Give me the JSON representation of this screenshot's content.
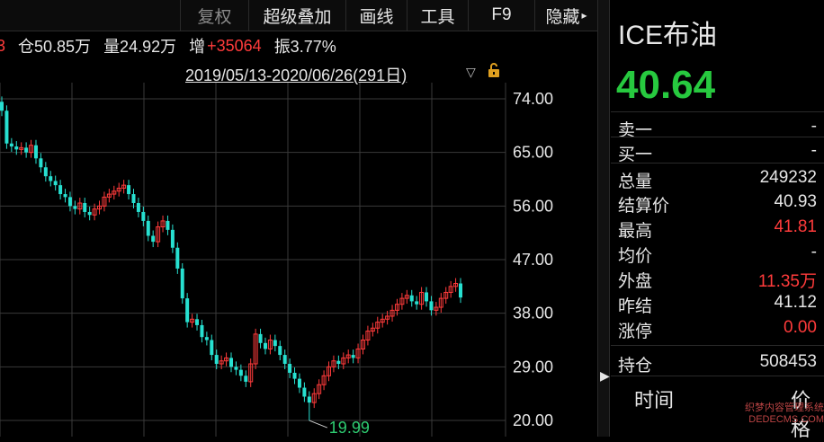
{
  "toolbar": {
    "items": [
      "复权",
      "超级叠加",
      "画线",
      "工具",
      "F9",
      "隐藏"
    ]
  },
  "infobar": {
    "open_interest": "仓50.85万",
    "volume": "量24.92万",
    "increase_label": "增",
    "increase_value": "+35064",
    "amplitude": "振3.77%"
  },
  "range_label": "2019/05/13-2020/06/26(291日)",
  "chart_data": {
    "type": "candlestick",
    "y_ticks": [
      "74.00",
      "65.00",
      "56.00",
      "47.00",
      "38.00",
      "29.00",
      "20.00"
    ],
    "ylim": [
      20.0,
      74.0
    ],
    "grid": true,
    "low_label": "19.99",
    "up_color": "#ff3b3b",
    "down_color": "#27e0d0",
    "closes": [
      72.0,
      66.5,
      66.0,
      65.5,
      65.8,
      65.0,
      66.2,
      64.0,
      62.5,
      61.0,
      60.2,
      59.5,
      58.0,
      57.5,
      56.0,
      55.5,
      56.5,
      55.0,
      54.5,
      55.5,
      56.0,
      57.5,
      58.0,
      58.5,
      59.0,
      59.5,
      58.0,
      56.5,
      55.0,
      53.5,
      51.0,
      50.0,
      52.5,
      53.5,
      52.0,
      49.0,
      45.5,
      40.5,
      36.5,
      37.0,
      36.0,
      34.0,
      33.5,
      31.0,
      29.5,
      30.0,
      30.5,
      29.0,
      28.5,
      27.5,
      26.5,
      29.5,
      34.5,
      33.0,
      32.0,
      33.5,
      32.5,
      31.0,
      29.5,
      28.0,
      27.0,
      25.5,
      24.0,
      23.0,
      24.5,
      26.0,
      27.5,
      29.0,
      30.0,
      29.5,
      30.5,
      31.0,
      30.5,
      32.0,
      33.5,
      35.0,
      35.5,
      36.5,
      37.0,
      37.5,
      38.5,
      39.5,
      40.5,
      41.0,
      40.0,
      39.5,
      41.5,
      40.0,
      38.5,
      39.0,
      40.5,
      41.5,
      42.5,
      43.0,
      40.64
    ]
  },
  "panel": {
    "title": "ICE布油",
    "price": "40.64",
    "rows": [
      {
        "label": "卖一",
        "value": "-",
        "color": "#e6e6e6"
      },
      {
        "label": "买一",
        "value": "-",
        "color": "#e6e6e6"
      },
      {
        "label": "总量",
        "value": "249232",
        "color": "#e6e6e6"
      },
      {
        "label": "结算价",
        "value": "40.93",
        "color": "#e6e6e6"
      },
      {
        "label": "最高",
        "value": "41.81",
        "color": "#ff3b3b"
      },
      {
        "label": "均价",
        "value": "-",
        "color": "#e6e6e6"
      },
      {
        "label": "外盘",
        "value": "11.35万",
        "color": "#ff3b3b"
      },
      {
        "label": "昨结",
        "value": "41.12",
        "color": "#e6e6e6"
      },
      {
        "label": "涨停",
        "value": "0.00",
        "color": "#ff3b3b"
      },
      {
        "label": "持仓",
        "value": "508453",
        "color": "#e6e6e6"
      }
    ],
    "time_header": "时间",
    "price_header": "价格"
  },
  "watermark": "织梦内容管理系统 DEDECMS.COM"
}
